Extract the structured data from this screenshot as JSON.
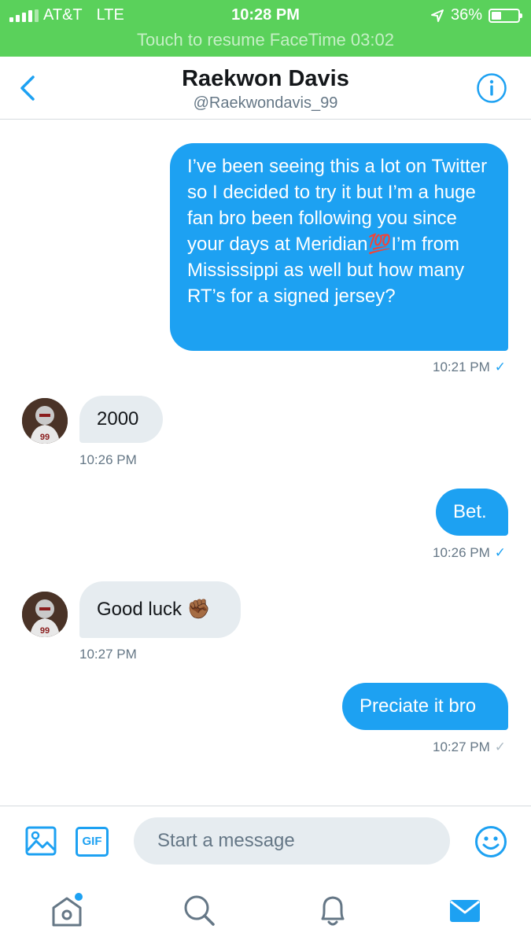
{
  "status_bar": {
    "carrier": "AT&T",
    "network": "LTE",
    "time": "10:28 PM",
    "battery": "36%",
    "battery_level": 0.36,
    "signal_bars": 4,
    "banner": "Touch to resume FaceTime 03:02"
  },
  "header": {
    "name": "Raekwon Davis",
    "handle": "@Raekwondavis_99",
    "back_icon": "chevron-left-icon",
    "info_icon": "info-icon"
  },
  "messages": [
    {
      "from": "me",
      "text": "I’ve been seeing this a lot on Twitter so I decided to try it but I’m a huge fan bro been following you since your days at Meridian💯I’m from Mississippi as well but how many RT’s for a signed jersey?",
      "time": "10:21 PM",
      "read": true
    },
    {
      "from": "them",
      "text": "2000",
      "time": "10:26 PM"
    },
    {
      "from": "me",
      "text": "Bet.",
      "time": "10:26 PM",
      "read": true
    },
    {
      "from": "them",
      "text": "Good luck ✊🏾",
      "time": "10:27 PM"
    },
    {
      "from": "me",
      "text": "Preciate it bro",
      "time": "10:27 PM",
      "read": false
    }
  ],
  "composer": {
    "placeholder": "Start a message",
    "gif_label": "GIF",
    "image_icon": "image-icon",
    "emoji_icon": "smiley-icon"
  },
  "tabbar": {
    "items": [
      "home-icon",
      "search-icon",
      "notifications-icon",
      "messages-icon"
    ],
    "active": "messages-icon",
    "home_has_dot": true
  },
  "colors": {
    "accent": "#1da1f2",
    "status_bar_bg": "#5ad15b",
    "incoming_bubble": "#e6ecf0"
  }
}
